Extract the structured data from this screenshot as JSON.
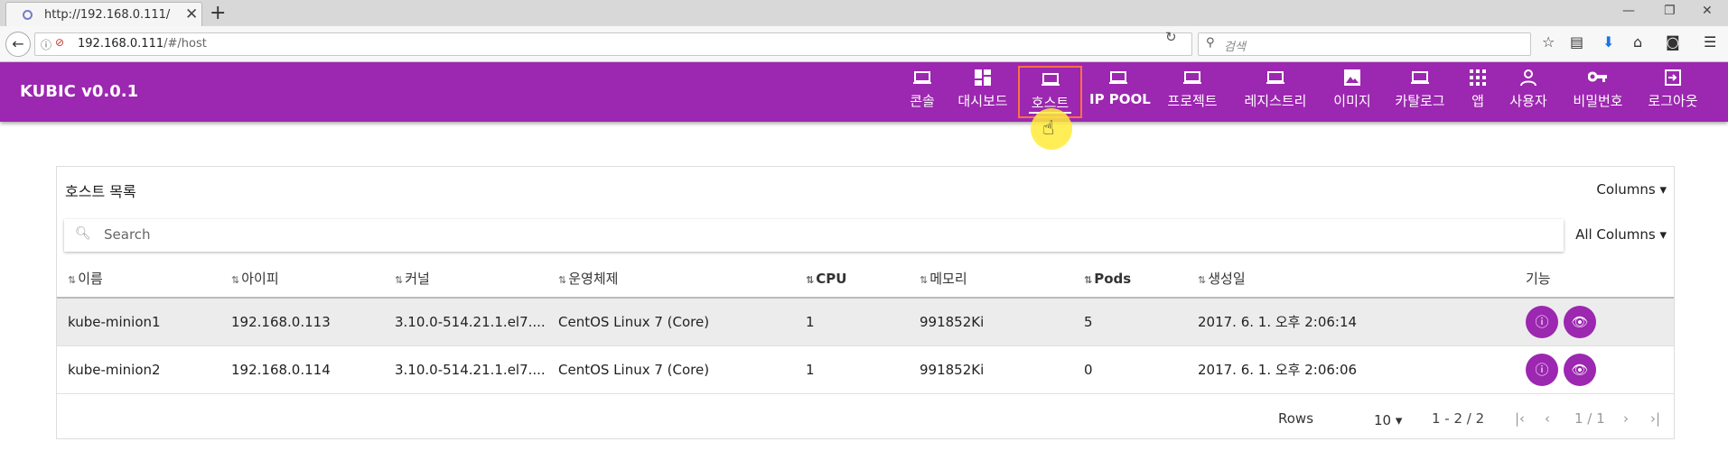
{
  "browser": {
    "tab_title": "http://192.168.0.111/",
    "url_host": "192.168.0.111",
    "url_path": "/#/host",
    "search_placeholder": "검색"
  },
  "app": {
    "brand": "KUBIC v0.0.1",
    "nav": [
      {
        "label": "콘솔",
        "icon": "laptop-icon"
      },
      {
        "label": "대시보드",
        "icon": "dashboard-icon"
      },
      {
        "label": "호스트",
        "icon": "laptop-icon",
        "active": true
      },
      {
        "label": "IP POOL",
        "icon": "laptop-icon"
      },
      {
        "label": "프로젝트",
        "icon": "laptop-icon"
      },
      {
        "label": "레지스트리",
        "icon": "laptop-icon"
      },
      {
        "label": "이미지",
        "icon": "image-icon"
      },
      {
        "label": "카탈로그",
        "icon": "laptop-icon"
      },
      {
        "label": "앱",
        "icon": "apps-grid-icon"
      },
      {
        "label": "사용자",
        "icon": "person-icon"
      },
      {
        "label": "비밀번호",
        "icon": "key-icon"
      },
      {
        "label": "로그아웃",
        "icon": "logout-icon"
      }
    ],
    "accent_color": "#9c27b0"
  },
  "table": {
    "title": "호스트 목록",
    "columns_button": "Columns",
    "search_placeholder": "Search",
    "all_columns_button": "All Columns",
    "headers": [
      "이름",
      "아이피",
      "커널",
      "운영체제",
      "CPU",
      "메모리",
      "Pods",
      "생성일",
      "기능"
    ],
    "rows": [
      {
        "name": "kube-minion1",
        "ip": "192.168.0.113",
        "kernel": "3.10.0-514.21.1.el7....",
        "os": "CentOS Linux 7 (Core)",
        "cpu": "1",
        "memory": "991852Ki",
        "pods": "5",
        "created": "2017. 6. 1. 오후 2:06:14"
      },
      {
        "name": "kube-minion2",
        "ip": "192.168.0.114",
        "kernel": "3.10.0-514.21.1.el7....",
        "os": "CentOS Linux 7 (Core)",
        "cpu": "1",
        "memory": "991852Ki",
        "pods": "0",
        "created": "2017. 6. 1. 오후 2:06:06"
      }
    ],
    "footer": {
      "rows_label": "Rows",
      "rows_value": "10",
      "range": "1 - 2 / 2",
      "page": "1 / 1"
    }
  }
}
